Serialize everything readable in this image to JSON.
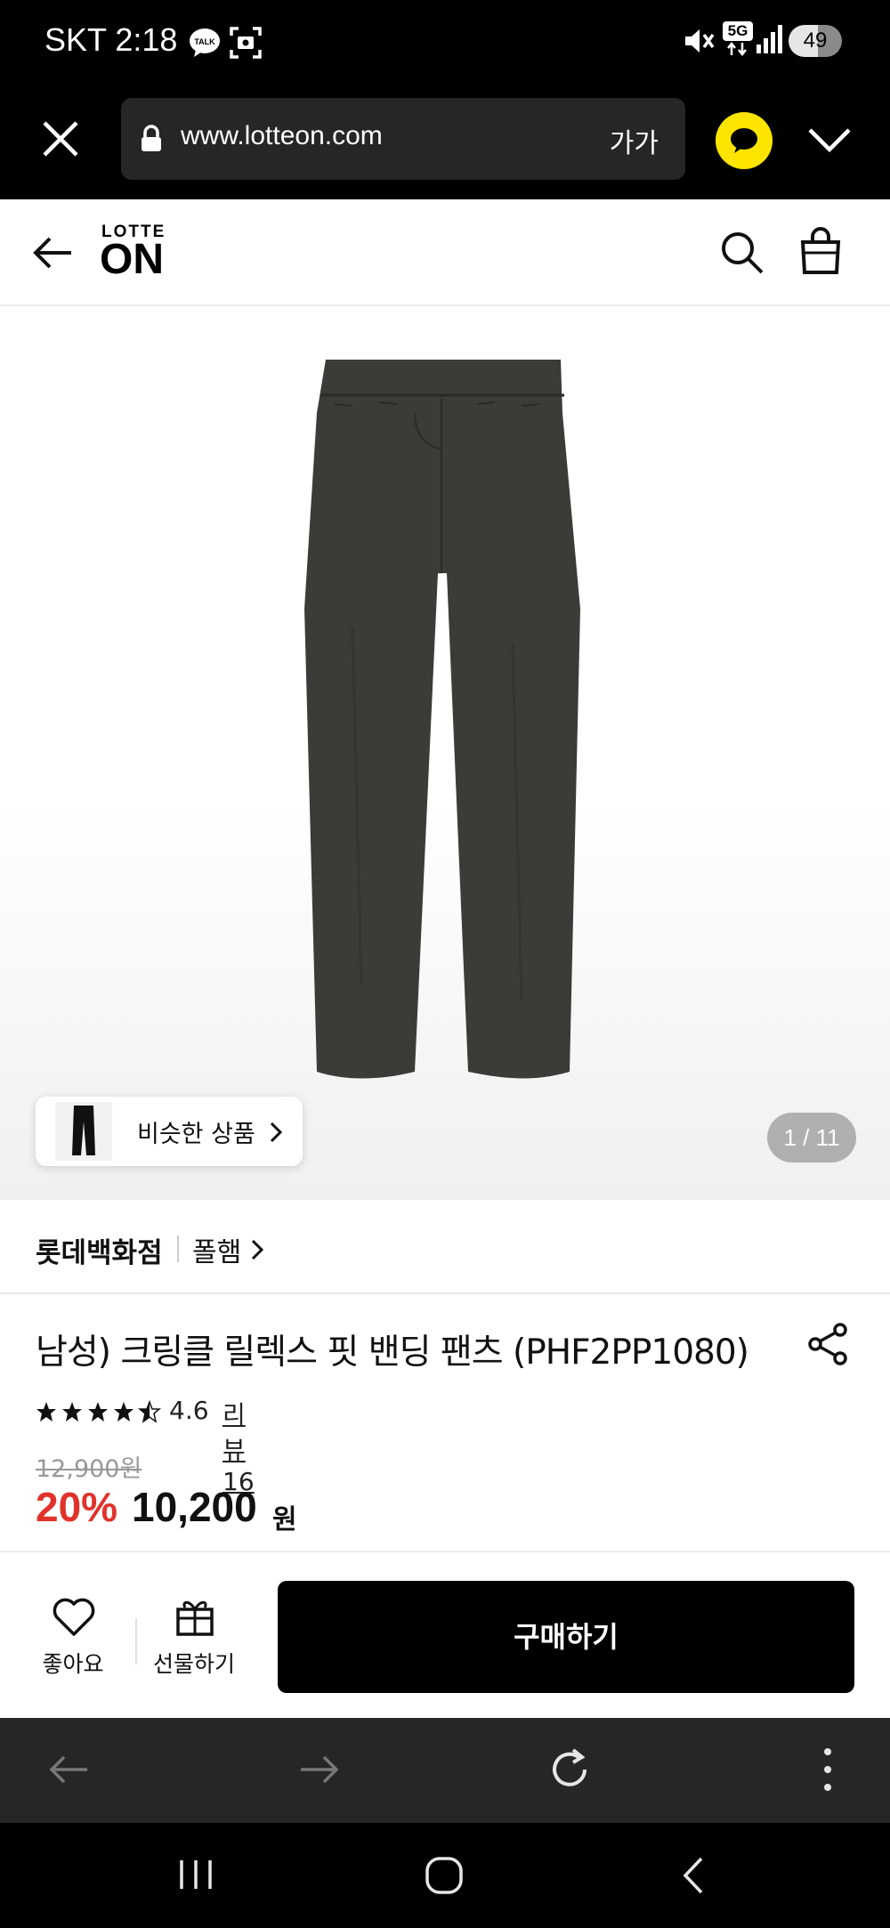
{
  "status_bar": {
    "carrier_time": "SKT 2:18",
    "network": "5G",
    "battery": "49"
  },
  "browser": {
    "url": "www.lotteon.com",
    "text_size_label": "가가"
  },
  "site": {
    "logo_top": "LOTTE",
    "logo_main": "ON"
  },
  "product_image": {
    "similar_label": "비슷한 상품",
    "counter": "1 / 11"
  },
  "seller": {
    "store": "롯데백화점",
    "brand": "폴햄"
  },
  "product": {
    "title": "남성) 크링클 릴렉스 핏 밴딩 팬츠 (PHF2PP1080)",
    "rating_value": "4.6",
    "rating": 4.6,
    "review_link": "리뷰 16",
    "original_price": "12,900원",
    "discount": "20%",
    "sale_price": "10,200",
    "sale_unit": "원"
  },
  "actions": {
    "like_label": "좋아요",
    "gift_label": "선물하기",
    "buy_label": "구매하기"
  },
  "colors": {
    "discount_red": "#e0322b",
    "kakao_yellow": "#fee500",
    "pants": "#3b3c37"
  }
}
